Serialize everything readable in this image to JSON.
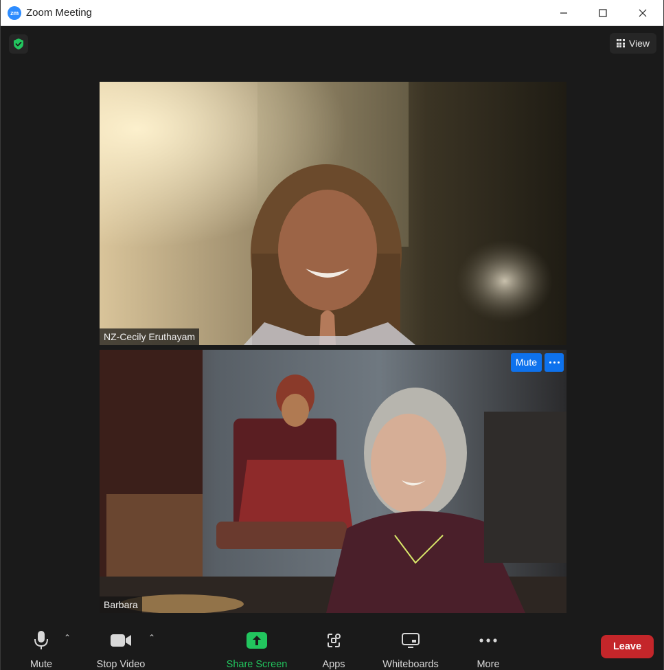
{
  "window": {
    "title": "Zoom Meeting",
    "logo_text": "zm",
    "controls": [
      "minimize-icon",
      "maximize-icon",
      "close-icon"
    ]
  },
  "top_bar": {
    "security_icon": "shield-check-icon",
    "view_label": "View"
  },
  "participants": [
    {
      "name": "NZ-Cecily Eruthayam"
    },
    {
      "name": "Barbara",
      "mute_label": "Mute",
      "more_icon": "ellipsis-icon"
    }
  ],
  "toolbar": {
    "mute_label": "Mute",
    "stop_video_label": "Stop Video",
    "share_screen_label": "Share Screen",
    "apps_label": "Apps",
    "whiteboards_label": "Whiteboards",
    "more_label": "More",
    "leave_label": "Leave"
  },
  "colors": {
    "accent_blue": "#0e72ed",
    "share_green": "#22c55e",
    "leave_red": "#c4262a",
    "background": "#1a1a1a"
  }
}
